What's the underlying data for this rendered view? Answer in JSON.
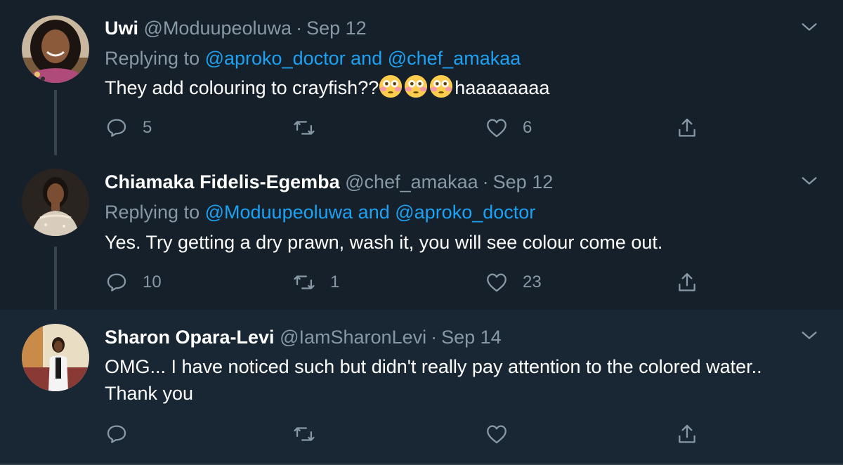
{
  "colors": {
    "background": "#15202b",
    "highlight_background": "#192734",
    "text": "#ffffff",
    "secondary": "#8899a6",
    "link": "#1da1f2",
    "thread_line": "#38444d"
  },
  "tweets": [
    {
      "name": "Uwi",
      "handle": "@Moduupeoluwa",
      "separator": "·",
      "date": "Sep 12",
      "replying_prefix": "Replying to",
      "mention_1": "@aproko_doctor",
      "joiner": "and",
      "mention_2": "@chef_amakaa",
      "text_before": "They add colouring to crayfish??",
      "emoji_name": "flushed-face-emoji",
      "text_after": "haaaaaaaa",
      "reply_count": "5",
      "retweet_count": "",
      "like_count": "6"
    },
    {
      "name": "Chiamaka Fidelis-Egemba",
      "handle": "@chef_amakaa",
      "separator": "·",
      "date": "Sep 12",
      "replying_prefix": "Replying to",
      "mention_1": "@Moduupeoluwa",
      "joiner": "and",
      "mention_2": "@aproko_doctor",
      "text": "Yes. Try getting a dry prawn, wash it, you will see colour come out.",
      "reply_count": "10",
      "retweet_count": "1",
      "like_count": "23"
    },
    {
      "name": "Sharon Opara-Levi",
      "handle": "@IamSharonLevi",
      "separator": "·",
      "date": "Sep 14",
      "text": "OMG... I have noticed such but didn't really pay attention to the colored water.. Thank you",
      "reply_count": "",
      "retweet_count": "",
      "like_count": ""
    }
  ],
  "icons": {
    "reply": "reply-icon",
    "retweet": "retweet-icon",
    "like": "heart-icon",
    "share": "share-icon",
    "more": "chevron-down-icon"
  }
}
